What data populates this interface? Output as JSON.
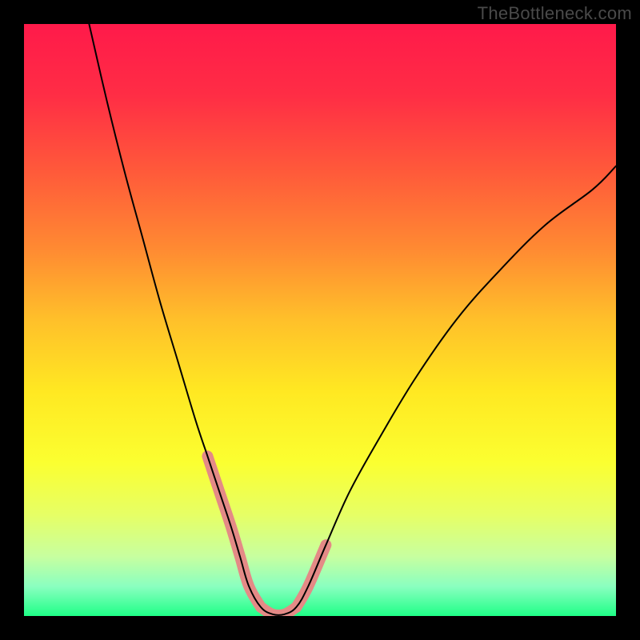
{
  "watermark": "TheBottleneck.com",
  "chart_data": {
    "type": "line",
    "title": "",
    "xlabel": "",
    "ylabel": "",
    "xlim": [
      0,
      100
    ],
    "ylim": [
      0,
      100
    ],
    "background_gradient": {
      "stops": [
        {
          "offset": 0.0,
          "color": "#ff1a4a"
        },
        {
          "offset": 0.12,
          "color": "#ff2d45"
        },
        {
          "offset": 0.25,
          "color": "#ff5a3a"
        },
        {
          "offset": 0.38,
          "color": "#ff8a32"
        },
        {
          "offset": 0.5,
          "color": "#ffc02a"
        },
        {
          "offset": 0.62,
          "color": "#ffe822"
        },
        {
          "offset": 0.74,
          "color": "#fbff30"
        },
        {
          "offset": 0.83,
          "color": "#e6ff66"
        },
        {
          "offset": 0.9,
          "color": "#c7ffa0"
        },
        {
          "offset": 0.95,
          "color": "#8affc0"
        },
        {
          "offset": 1.0,
          "color": "#1fff87"
        }
      ]
    },
    "series": [
      {
        "name": "bottleneck-curve",
        "stroke": "#000000",
        "stroke_width": 2,
        "x": [
          11.0,
          14.0,
          17.0,
          20.0,
          23.0,
          26.0,
          29.0,
          31.0,
          33.0,
          35.0,
          36.5,
          38.0,
          40.0,
          42.0,
          44.0,
          46.0,
          48.0,
          51.0,
          55.0,
          60.0,
          66.0,
          73.0,
          80.0,
          88.0,
          96.0,
          100.0
        ],
        "y": [
          100.0,
          87.0,
          75.0,
          64.0,
          53.0,
          43.0,
          33.0,
          27.0,
          21.0,
          15.0,
          10.0,
          5.0,
          1.5,
          0.3,
          0.3,
          1.5,
          5.0,
          12.0,
          21.0,
          30.0,
          40.0,
          50.0,
          58.0,
          66.0,
          72.0,
          76.0
        ]
      }
    ],
    "highlight_segments": [
      {
        "name": "left-descent-highlight",
        "stroke": "#e48a86",
        "stroke_width": 14,
        "x": [
          31.0,
          33.0,
          35.0,
          36.5,
          38.0,
          40.0
        ],
        "y": [
          27.0,
          21.0,
          15.0,
          10.0,
          5.0,
          1.5
        ]
      },
      {
        "name": "valley-floor-highlight",
        "stroke": "#e48a86",
        "stroke_width": 14,
        "x": [
          40.0,
          42.0,
          44.0,
          46.0
        ],
        "y": [
          1.5,
          0.3,
          0.3,
          1.5
        ]
      },
      {
        "name": "right-ascent-highlight",
        "stroke": "#e48a86",
        "stroke_width": 14,
        "x": [
          46.0,
          48.0,
          51.0
        ],
        "y": [
          1.5,
          5.0,
          12.0
        ]
      }
    ]
  }
}
